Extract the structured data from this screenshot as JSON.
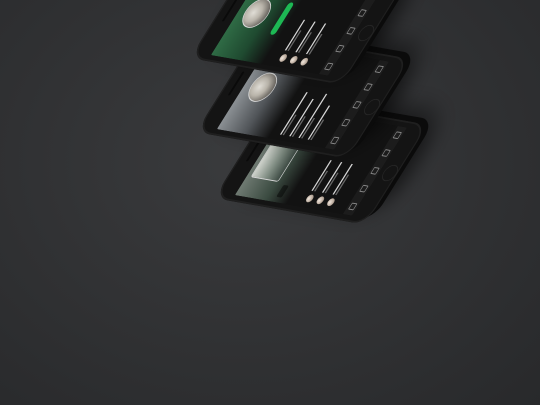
{
  "scene": {
    "description_free": true,
    "background_color": "#303133",
    "accent_color": "#1db954"
  },
  "phones": [
    {
      "screen_theme": "green",
      "name_text": "",
      "sub_text": "",
      "button_text": ""
    },
    {
      "screen_theme": "gray",
      "name_text": "",
      "sub_text": "",
      "button_text": ""
    },
    {
      "screen_theme": "photo",
      "name_text": "",
      "sub_text": "",
      "button_text": ""
    }
  ]
}
